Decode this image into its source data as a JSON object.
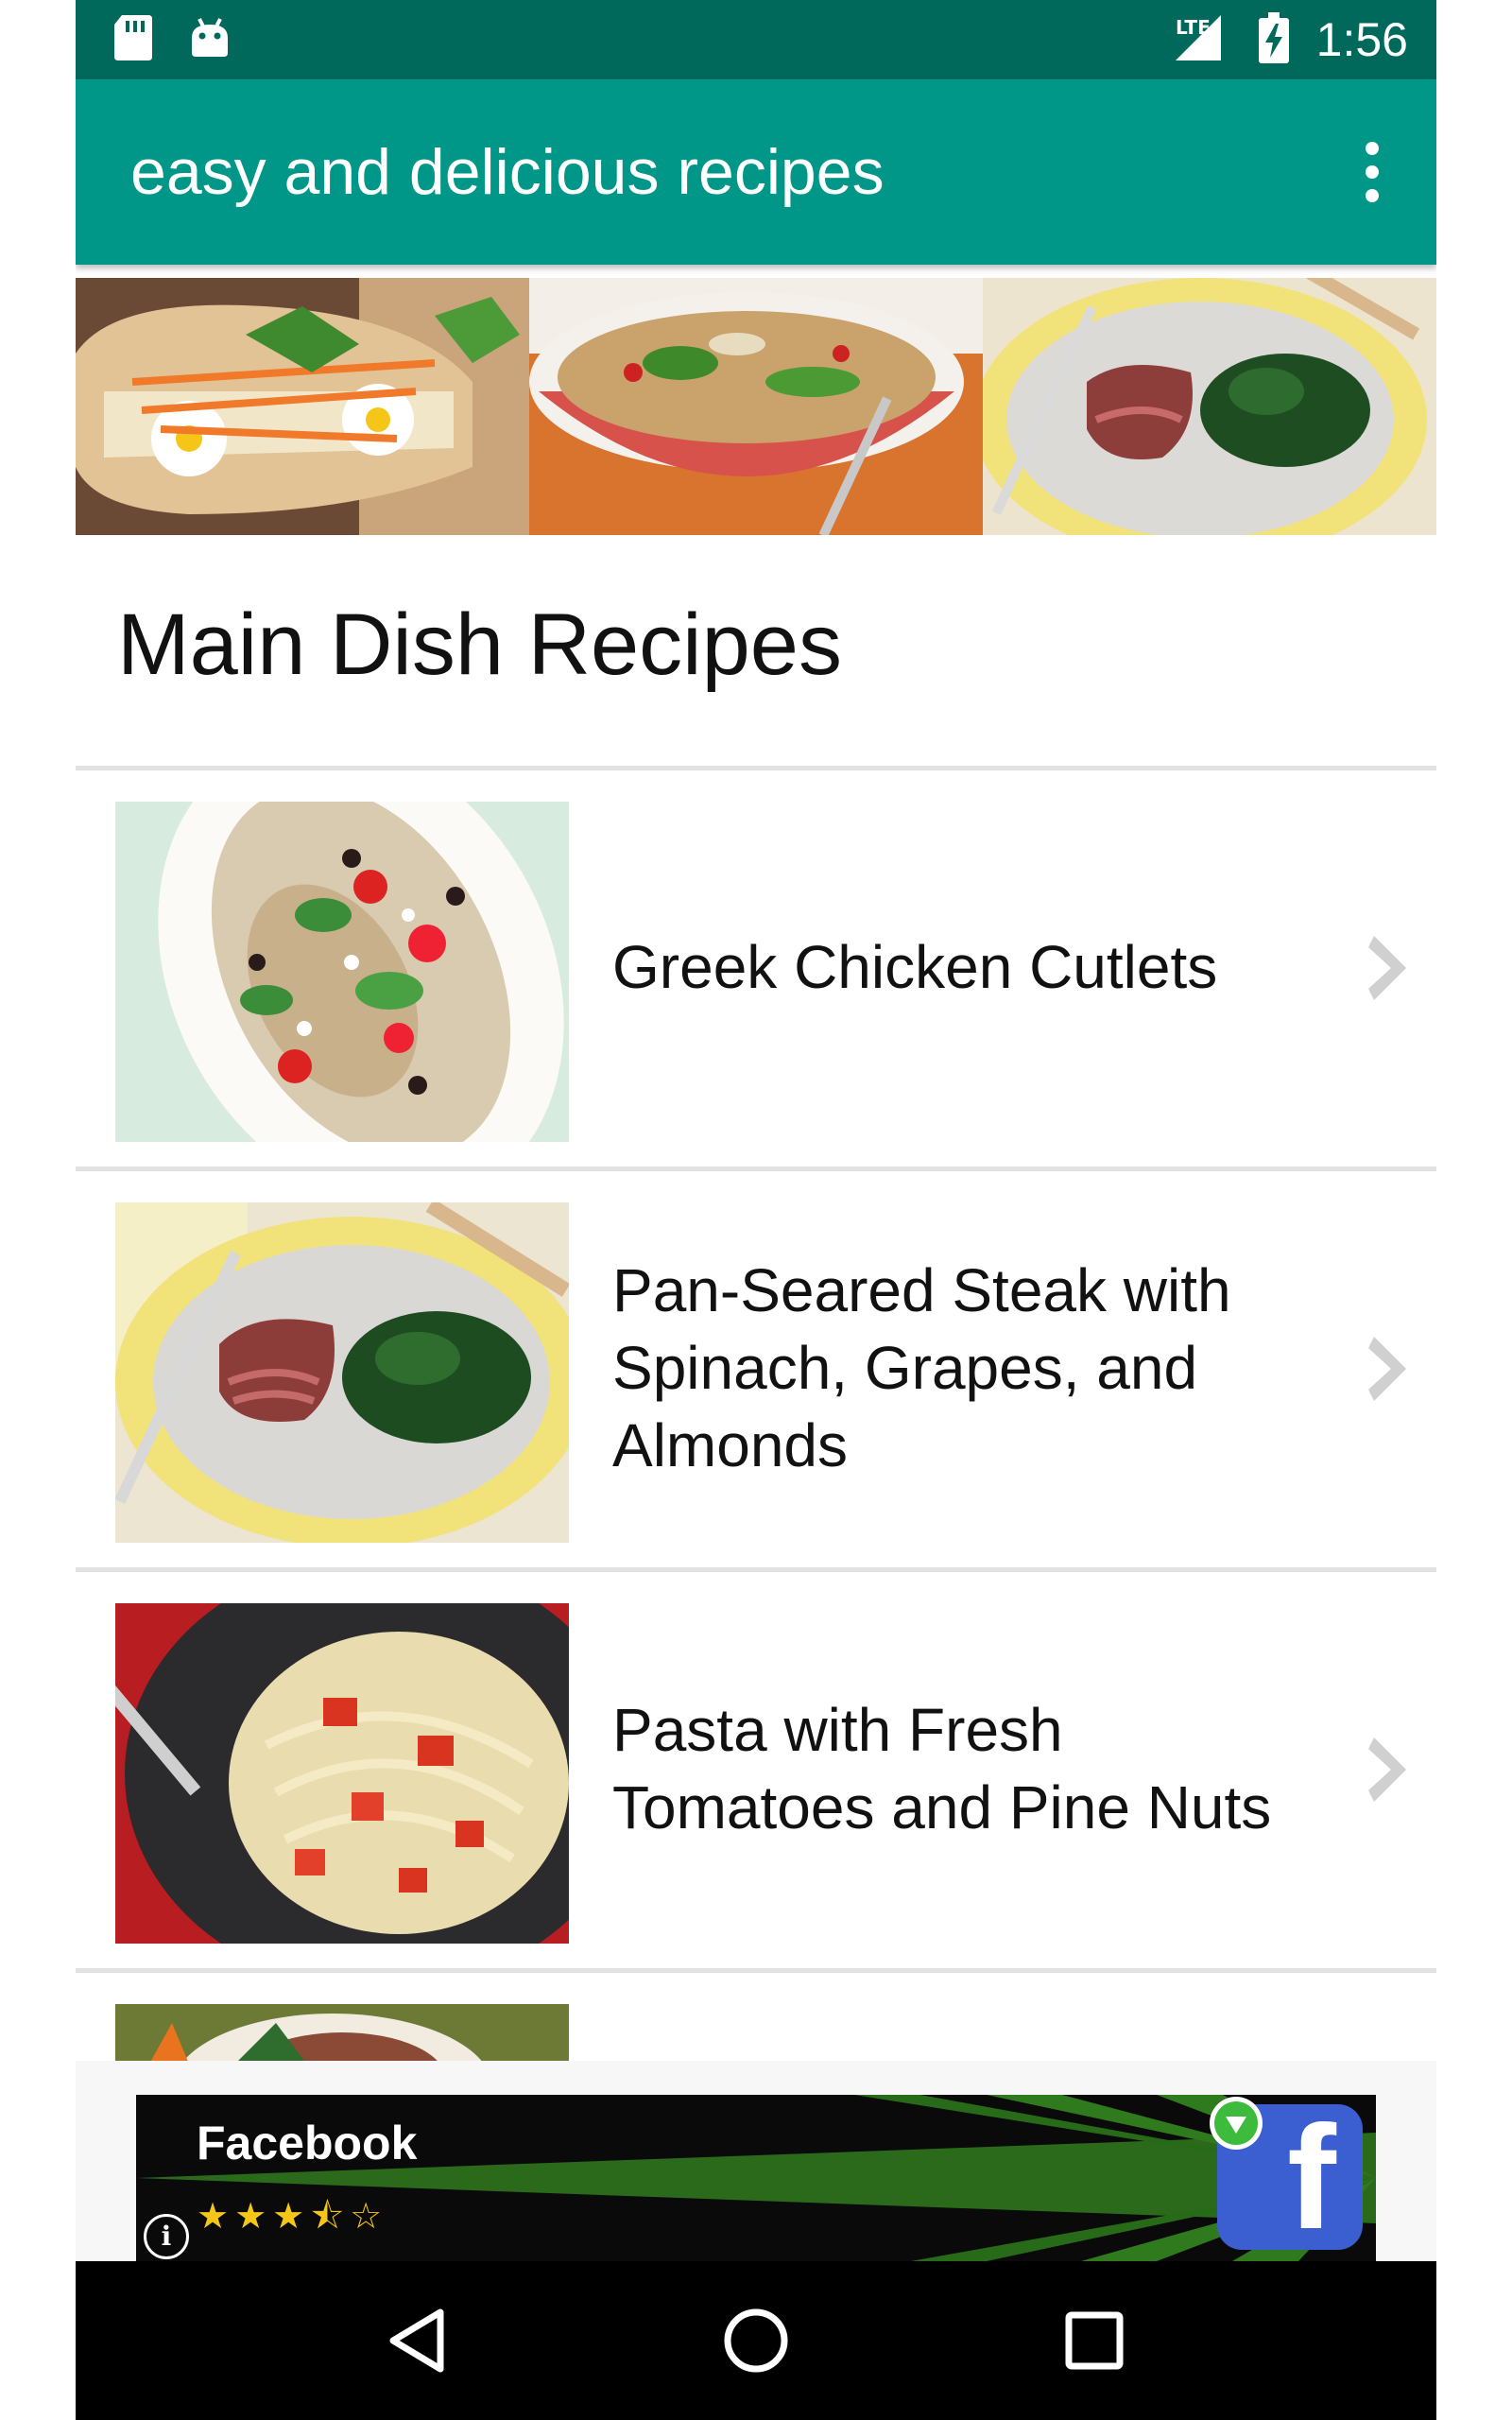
{
  "status_bar": {
    "time": "1:56",
    "network": "LTE",
    "icons": [
      "sd-card-icon",
      "android-icon",
      "lte-signal-icon",
      "battery-charging-icon"
    ]
  },
  "app_bar": {
    "title": "easy and delicious recipes",
    "overflow_icon": "more-vert-icon"
  },
  "section": {
    "heading": "Main Dish Recipes"
  },
  "recipes": [
    {
      "title": "Greek Chicken Cutlets"
    },
    {
      "title": "Pan-Seared Steak with Spinach, Grapes, and Almonds"
    },
    {
      "title": "Pasta with Fresh Tomatoes and Pine Nuts"
    }
  ],
  "ad": {
    "title": "Facebook",
    "rating": 3.5,
    "rating_max": 5,
    "stars_text": "★★★⯪☆",
    "brand_letter": "f",
    "brand_color": "#3b5ed1"
  },
  "colors": {
    "status_bar": "#00695c",
    "app_bar": "#009688"
  },
  "nav_bar": {
    "icons": [
      "back-icon",
      "home-icon",
      "recents-icon"
    ]
  }
}
